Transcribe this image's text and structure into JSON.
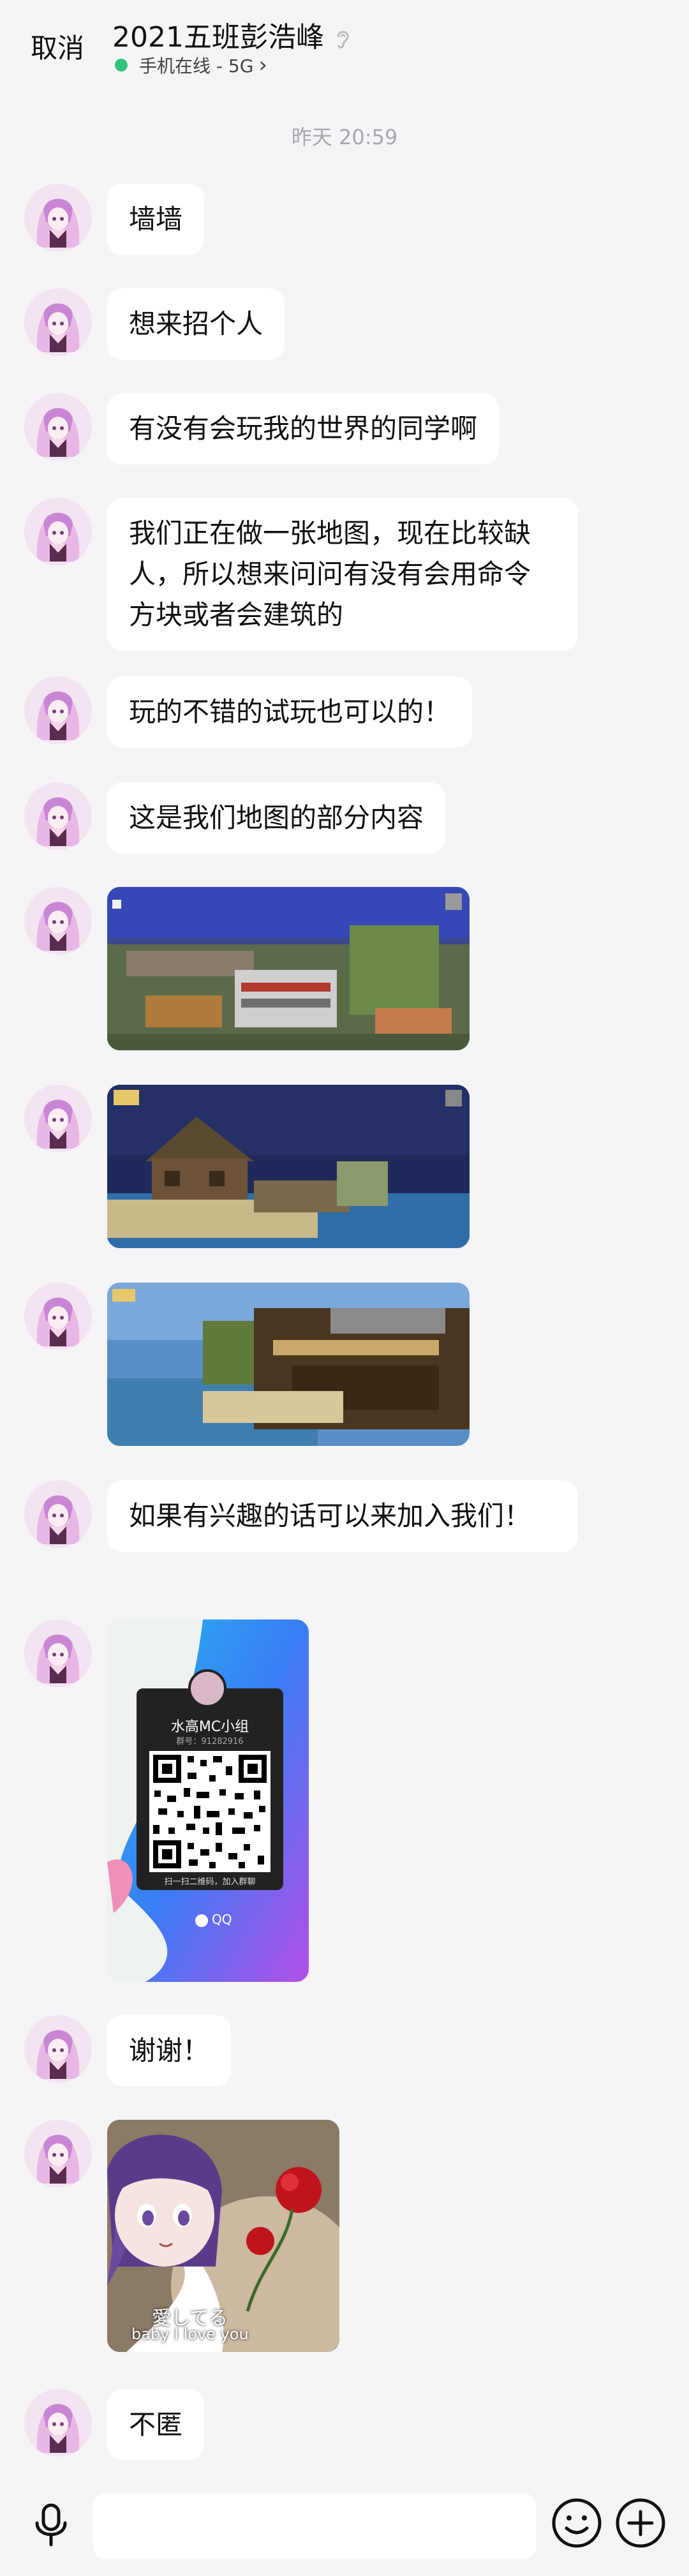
{
  "header": {
    "cancel_label": "取消",
    "title": "2021五班彭浩峰",
    "status": "手机在线 - 5G",
    "status_chevron": "›"
  },
  "timestamp": "昨天 20:59",
  "messages": [
    {
      "type": "text",
      "text": "墙墙"
    },
    {
      "type": "text",
      "text": "想来招个人"
    },
    {
      "type": "text",
      "text": "有没有会玩我的世界的同学啊"
    },
    {
      "type": "text",
      "text": "我们正在做一张地图，现在比较缺人，所以想来问问有没有会用命令方块或者会建筑的"
    },
    {
      "type": "text",
      "text": "玩的不错的试玩也可以的！"
    },
    {
      "type": "text",
      "text": "这是我们地图的部分内容"
    },
    {
      "type": "image",
      "description": "minecraft-screenshot-1"
    },
    {
      "type": "image",
      "description": "minecraft-screenshot-2"
    },
    {
      "type": "image",
      "description": "minecraft-screenshot-3"
    },
    {
      "type": "text",
      "text": "如果有兴趣的话可以来加入我们！"
    },
    {
      "type": "qr",
      "group_name": "水高MC小组",
      "group_id": "群号：91282916",
      "hint": "扫一扫二维码，加入群聊",
      "brand": "QQ"
    },
    {
      "type": "text",
      "text": "谢谢！"
    },
    {
      "type": "image",
      "caption_jp": "愛してる",
      "caption_en": "baby I love you"
    },
    {
      "type": "text",
      "text": "不匿"
    }
  ],
  "icons": {
    "ear": "ear-icon",
    "mic": "microphone-icon",
    "emoji": "smiley-icon",
    "plus": "plus-icon"
  },
  "colors": {
    "background": "#f5f5f7",
    "bubble": "#ffffff",
    "online": "#31c27c"
  }
}
